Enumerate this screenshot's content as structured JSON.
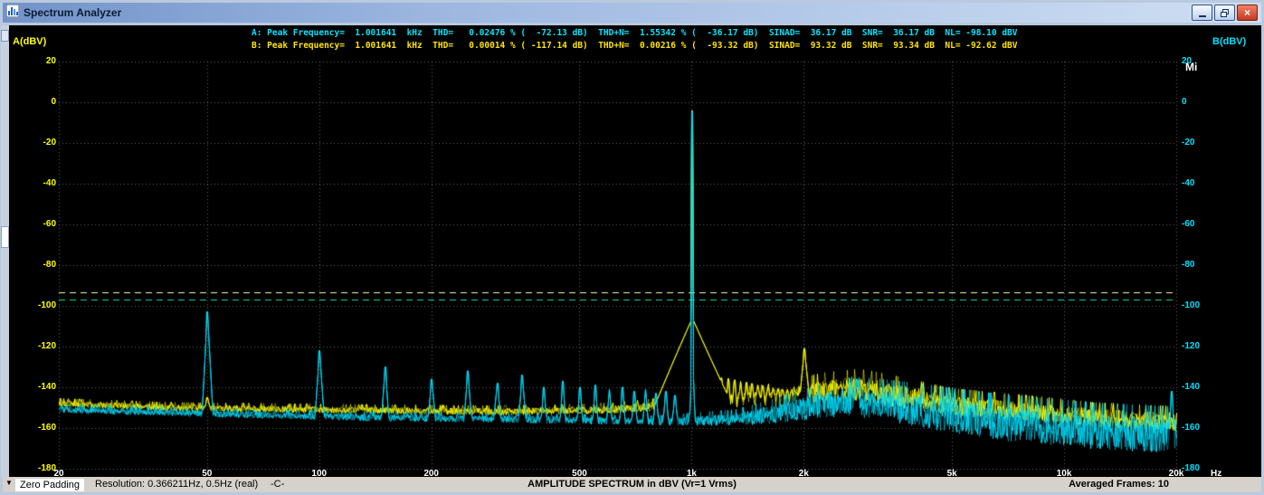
{
  "window": {
    "title": "Spectrum Analyzer",
    "close_glyph": "×"
  },
  "readouts": {
    "a": "A: Peak Frequency=  1.001641  kHz  THD=   0.02476 % (  -72.13 dB)  THD+N=  1.55342 % (  -36.17 dB)  SINAD=  36.17 dB  SNR=  36.17 dB  NL= -98.10 dBV",
    "b": "B: Peak Frequency=  1.001641  kHz  THD=   0.00014 % ( -117.14 dB)  THD+N=  0.00216 % (  -93.32 dB)  SINAD=  93.32 dB  SNR=  93.34 dB  NL= -92.62 dBV"
  },
  "labels": {
    "a_axis": "A(dBV)",
    "b_axis": "B(dBV)",
    "hz": "Hz",
    "mi": "Mi"
  },
  "status": {
    "dropdown": "▼",
    "zero_padding": "Zero Padding",
    "resolution": "Resolution: 0.366211Hz, 0.5Hz (real)",
    "c": "-C-",
    "center": "AMPLITUDE SPECTRUM in dBV (Vr=1 Vrms)",
    "averaged": "Averaged Frames: 10"
  },
  "icons": {
    "minimize": "horizontal-bar",
    "restore": "overlapping-squares",
    "close": "x-cross",
    "dropdown": "down-triangle"
  },
  "chart_data": {
    "type": "line",
    "title": "AMPLITUDE SPECTRUM in dBV (Vr=1 Vrms)",
    "x_axis": {
      "scale": "log",
      "min": 20,
      "max": 20000,
      "unit": "Hz",
      "ticks": [
        {
          "f": 20,
          "label": "20"
        },
        {
          "f": 50,
          "label": "50"
        },
        {
          "f": 100,
          "label": "100"
        },
        {
          "f": 200,
          "label": "200"
        },
        {
          "f": 500,
          "label": "500"
        },
        {
          "f": 1000,
          "label": "1k"
        },
        {
          "f": 2000,
          "label": "2k"
        },
        {
          "f": 5000,
          "label": "5k"
        },
        {
          "f": 10000,
          "label": "10k"
        },
        {
          "f": 20000,
          "label": "20k"
        }
      ]
    },
    "y_axis": {
      "min": -180,
      "max": 20,
      "step": 20,
      "unit": "dBV",
      "left_label": "A(dBV)",
      "right_label": "B(dBV)"
    },
    "grid": true,
    "cursors": [
      {
        "db": -93.3,
        "color": "#ffffa0"
      },
      {
        "db": -97.0,
        "color": "#00e2a8"
      }
    ],
    "series": [
      {
        "name": "A",
        "color": "#ffff00",
        "peak_frequency_khz": 1.001641,
        "thd_pct": 0.02476,
        "thd_db": -72.13,
        "thdn_pct": 1.55342,
        "thdn_db": -36.17,
        "sinad_db": 36.17,
        "snr_db": 36.17,
        "nl_dbv": -98.1,
        "floor": [
          [
            20,
            -148
          ],
          [
            40,
            -150
          ],
          [
            100,
            -151
          ],
          [
            300,
            -152
          ],
          [
            600,
            -151
          ],
          [
            1000,
            -148
          ],
          [
            1400,
            -146
          ],
          [
            1800,
            -145
          ],
          [
            2300,
            -142
          ],
          [
            2800,
            -141
          ],
          [
            3500,
            -144
          ],
          [
            5000,
            -149
          ],
          [
            8000,
            -152
          ],
          [
            12000,
            -155
          ],
          [
            20000,
            -157
          ]
        ],
        "spread": [
          [
            20,
            1.5
          ],
          [
            500,
            1.8
          ],
          [
            1000,
            2.5
          ],
          [
            1500,
            4
          ],
          [
            2200,
            5.5
          ],
          [
            3000,
            6
          ],
          [
            5000,
            5
          ],
          [
            12000,
            4.5
          ],
          [
            20000,
            4.5
          ]
        ],
        "peaks": [
          {
            "f": 1001.641,
            "db": -4.3,
            "w": 42,
            "skirt": -106
          },
          {
            "f": 50,
            "db": -145,
            "w": 3
          },
          {
            "f": 1502,
            "db": -141,
            "w": 3
          },
          {
            "f": 2003,
            "db": -121,
            "w": 5
          },
          {
            "f": 2500,
            "db": -139,
            "w": 3
          },
          {
            "f": 3005,
            "db": -141,
            "w": 3
          },
          {
            "f": 4010,
            "db": -147,
            "w": 3
          }
        ],
        "comb": {
          "start": 1050,
          "step": 50,
          "end": 1950,
          "db_start": -133,
          "db_end": -143,
          "w": 2
        }
      },
      {
        "name": "B",
        "color": "#00e0ff",
        "peak_frequency_khz": 1.001641,
        "thd_pct": 0.00014,
        "thd_db": -117.14,
        "thdn_pct": 0.00216,
        "thdn_db": -93.32,
        "sinad_db": 93.32,
        "snr_db": 93.34,
        "nl_dbv": -92.62,
        "floor": [
          [
            20,
            -151
          ],
          [
            50,
            -153
          ],
          [
            150,
            -155
          ],
          [
            400,
            -156
          ],
          [
            800,
            -157
          ],
          [
            1300,
            -156
          ],
          [
            1700,
            -153
          ],
          [
            2200,
            -149
          ],
          [
            2700,
            -147
          ],
          [
            3300,
            -149
          ],
          [
            4500,
            -153
          ],
          [
            7000,
            -158
          ],
          [
            12000,
            -162
          ],
          [
            20000,
            -164
          ]
        ],
        "spread": [
          [
            20,
            1.6
          ],
          [
            800,
            1.8
          ],
          [
            1300,
            3
          ],
          [
            1800,
            5
          ],
          [
            2500,
            7
          ],
          [
            4000,
            8
          ],
          [
            8000,
            8.5
          ],
          [
            20000,
            8.5
          ]
        ],
        "peaks": [
          {
            "f": 50,
            "db": -103,
            "w": 6
          },
          {
            "f": 100,
            "db": -122,
            "w": 5
          },
          {
            "f": 150,
            "db": -130,
            "w": 4
          },
          {
            "f": 200,
            "db": -136,
            "w": 4
          },
          {
            "f": 250,
            "db": -132,
            "w": 4
          },
          {
            "f": 300,
            "db": -138,
            "w": 4
          },
          {
            "f": 350,
            "db": -134,
            "w": 4
          },
          {
            "f": 400,
            "db": -140,
            "w": 3
          },
          {
            "f": 450,
            "db": -137,
            "w": 3
          },
          {
            "f": 500,
            "db": -140,
            "w": 3
          },
          {
            "f": 550,
            "db": -139,
            "w": 3
          },
          {
            "f": 600,
            "db": -141,
            "w": 3
          },
          {
            "f": 650,
            "db": -140,
            "w": 3
          },
          {
            "f": 700,
            "db": -142,
            "w": 3
          },
          {
            "f": 750,
            "db": -141,
            "w": 3
          },
          {
            "f": 800,
            "db": -143,
            "w": 3
          },
          {
            "f": 850,
            "db": -142,
            "w": 3
          },
          {
            "f": 900,
            "db": -144,
            "w": 3
          },
          {
            "f": 1001.641,
            "db": -4.8,
            "w": 3,
            "skirt": -120
          },
          {
            "f": 2770,
            "db": -136,
            "w": 3
          },
          {
            "f": 19400,
            "db": -142,
            "w": 3
          }
        ]
      }
    ]
  }
}
